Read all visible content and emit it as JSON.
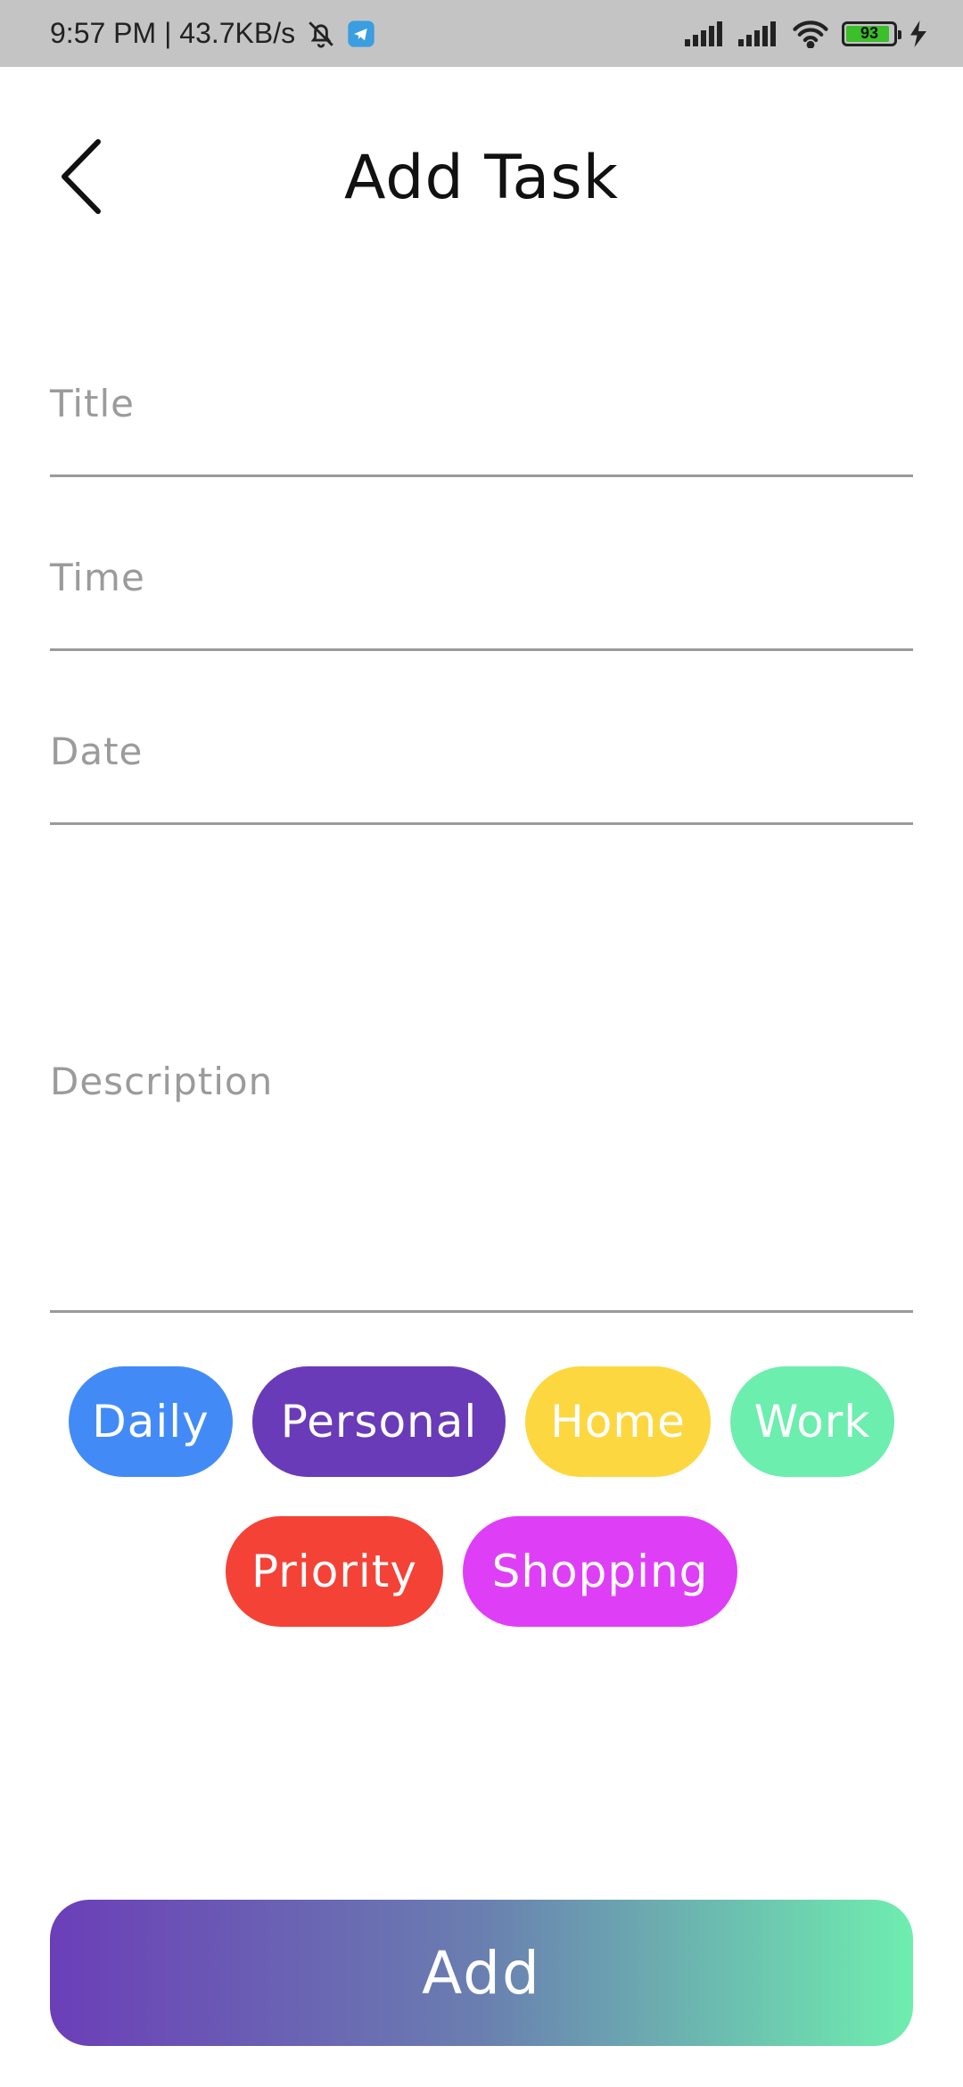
{
  "status_bar": {
    "time_speed": "9:57 PM | 43.7KB/s",
    "battery_level": "93",
    "battery_percent": 93,
    "icons": [
      "mute-bell-icon",
      "telegram-icon",
      "signal-icon",
      "signal-icon",
      "wifi-icon",
      "battery-icon",
      "charging-icon"
    ]
  },
  "header": {
    "title": "Add Task",
    "back_icon": "chevron-left-icon"
  },
  "form": {
    "title_placeholder": "Title",
    "time_placeholder": "Time",
    "date_placeholder": "Date",
    "description_placeholder": "Description"
  },
  "categories": [
    {
      "label": "Daily",
      "color": "#428bf7"
    },
    {
      "label": "Personal",
      "color": "#6a3bb8"
    },
    {
      "label": "Home",
      "color": "#fdd73f"
    },
    {
      "label": "Work",
      "color": "#6ceeae"
    },
    {
      "label": "Priority",
      "color": "#f44236"
    },
    {
      "label": "Shopping",
      "color": "#df3ef7"
    }
  ],
  "actions": {
    "add_label": "Add"
  },
  "colors": {
    "gradient_start": "#6b3eb8",
    "gradient_end": "#6eeeaf",
    "status_bar_bg": "#c4c4c4"
  }
}
